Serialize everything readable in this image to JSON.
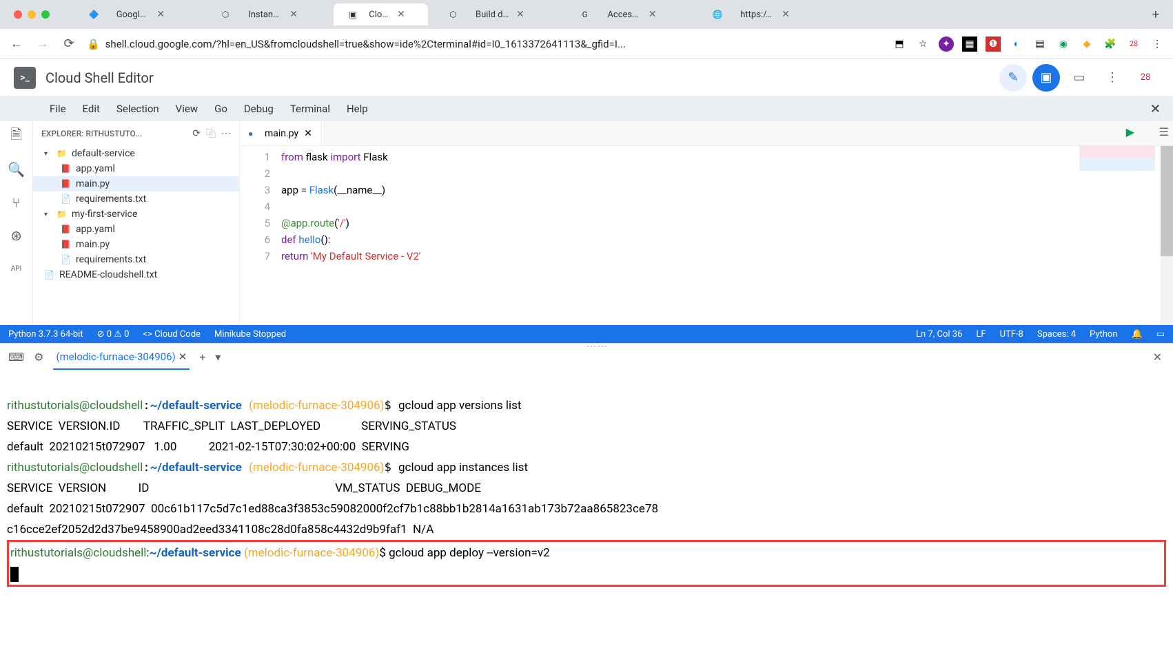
{
  "browser": {
    "tabs": [
      {
        "title": "Google Certified Ass",
        "favicon": "🔷"
      },
      {
        "title": "Instances – App Engi",
        "favicon": "⬡"
      },
      {
        "title": "Cloud Shell",
        "favicon": "▣",
        "active": true
      },
      {
        "title": "Build details – Cloud",
        "favicon": "⬡"
      },
      {
        "title": "Access to bucket sta",
        "favicon": "G"
      },
      {
        "title": "https://melodic-furna",
        "favicon": "🌐"
      }
    ],
    "url": "shell.cloud.google.com/?hl=en_US&fromcloudshell=true&show=ide%2Cterminal#id=I0_1613372641113&_gfid=I..."
  },
  "app": {
    "title": "Cloud Shell Editor",
    "badge": "28"
  },
  "menu": [
    "File",
    "Edit",
    "Selection",
    "View",
    "Go",
    "Debug",
    "Terminal",
    "Help"
  ],
  "explorer": {
    "title": "EXPLORER: RITHUSTUTO...",
    "tree": [
      {
        "type": "folder",
        "name": "default-service",
        "open": true,
        "children": [
          {
            "type": "file",
            "name": "app.yaml",
            "icon": "📕"
          },
          {
            "type": "file",
            "name": "main.py",
            "icon": "📕",
            "selected": true
          },
          {
            "type": "file",
            "name": "requirements.txt",
            "icon": "📄"
          }
        ]
      },
      {
        "type": "folder",
        "name": "my-first-service",
        "open": true,
        "children": [
          {
            "type": "file",
            "name": "app.yaml",
            "icon": "📕"
          },
          {
            "type": "file",
            "name": "main.py",
            "icon": "📕"
          },
          {
            "type": "file",
            "name": "requirements.txt",
            "icon": "📄"
          }
        ]
      },
      {
        "type": "file",
        "name": "README-cloudshell.txt",
        "icon": "📄"
      }
    ]
  },
  "editor": {
    "tab": "main.py",
    "lines": [
      {
        "n": 1,
        "html": "<span class='kw'>from</span> <span class='nm'>flask</span> <span class='kw'>import</span> <span class='nm'>Flask</span>"
      },
      {
        "n": 2,
        "html": ""
      },
      {
        "n": 3,
        "html": "<span class='nm'>app</span> = <span class='fn'>Flask</span>(<span class='nm'>__name__</span>)"
      },
      {
        "n": 4,
        "html": ""
      },
      {
        "n": 5,
        "html": "<span class='dec'>@app.route</span>(<span class='str'>'/'</span>)"
      },
      {
        "n": 6,
        "html": "<span class='kw'>def</span> <span class='fn'>hello</span>():"
      },
      {
        "n": 7,
        "html": "    <span class='kw'>return</span> <span class='str'>'My Default Service - V2'</span>"
      }
    ]
  },
  "status": {
    "left1": "Python 3.7.3 64-bit",
    "left2": "⊘ 0 ⚠ 0",
    "left3": "<> Cloud Code",
    "left4": "Minikube Stopped",
    "right1": "Ln 7, Col 36",
    "right2": "LF",
    "right3": "UTF-8",
    "right4": "Spaces: 4",
    "right5": "Python"
  },
  "terminal": {
    "tab": "(melodic-furnace-304906)",
    "prompt_user": "rithustutorials@cloudshell",
    "prompt_path": "~/default-service",
    "prompt_proj": "(melodic-furnace-304906)",
    "cmd1": "gcloud app versions list",
    "hdr1": "SERVICE  VERSION.ID        TRAFFIC_SPLIT  LAST_DEPLOYED              SERVING_STATUS",
    "row1": "default  20210215t072907   1.00           2021-02-15T07:30:02+00:00  SERVING",
    "cmd2": "gcloud app instances list",
    "hdr2": "SERVICE  VERSION           ID                                                                VM_STATUS  DEBUG_MODE",
    "row2a": "default  20210215t072907  00c61b117c5d7c1ed88ca3f3853c59082000f2cf7b1c88bb1b2814a1631ab173b72aa865823ce78",
    "row2b": "c16cce2ef2052d2d37be9458900ad2eed3341108c28d0fa858c4432d9b9faf1  N/A",
    "cmd3": "gcloud app deploy --version=v2"
  }
}
